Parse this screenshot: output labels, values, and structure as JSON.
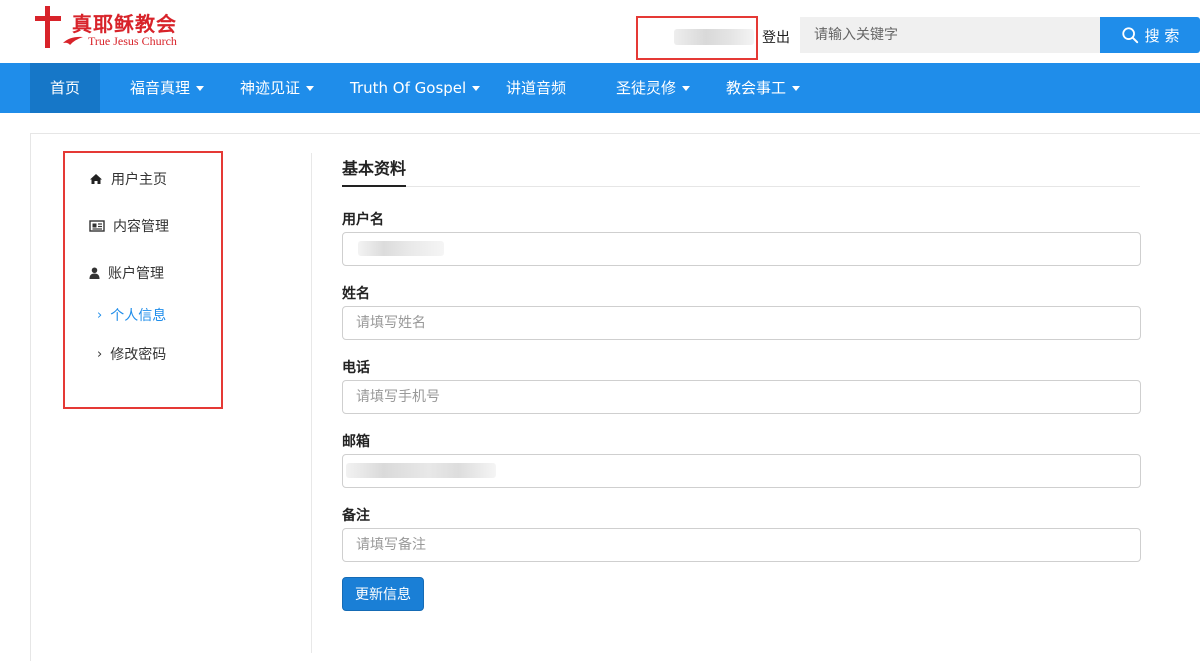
{
  "header": {
    "logo_cn": "真耶稣教会",
    "logo_en": "True Jesus Church",
    "logout_label": "登出",
    "search_placeholder": "请输入关键字",
    "search_button": "搜 索"
  },
  "nav": {
    "items": [
      {
        "label": "首页",
        "dropdown": false,
        "active": true
      },
      {
        "label": "福音真理",
        "dropdown": true,
        "active": false
      },
      {
        "label": "神迹见证",
        "dropdown": true,
        "active": false
      },
      {
        "label": "Truth Of Gospel",
        "dropdown": true,
        "active": false
      },
      {
        "label": "讲道音频",
        "dropdown": false,
        "active": false
      },
      {
        "label": "圣徒灵修",
        "dropdown": true,
        "active": false
      },
      {
        "label": "教会事工",
        "dropdown": true,
        "active": false
      }
    ]
  },
  "sidebar": {
    "items": [
      {
        "label": "用户主页",
        "icon": "home-icon"
      },
      {
        "label": "内容管理",
        "icon": "newspaper-icon"
      },
      {
        "label": "账户管理",
        "icon": "user-icon"
      }
    ],
    "sub_items": [
      {
        "label": "个人信息",
        "active": true
      },
      {
        "label": "修改密码",
        "active": false
      }
    ]
  },
  "form": {
    "title": "基本资料",
    "fields": {
      "username": {
        "label": "用户名",
        "value": "",
        "placeholder": ""
      },
      "name": {
        "label": "姓名",
        "value": "",
        "placeholder": "请填写姓名"
      },
      "phone": {
        "label": "电话",
        "value": "",
        "placeholder": "请填写手机号"
      },
      "email": {
        "label": "邮箱",
        "value": "",
        "placeholder": ""
      },
      "note": {
        "label": "备注",
        "value": "",
        "placeholder": "请填写备注"
      }
    },
    "submit_label": "更新信息"
  },
  "colors": {
    "primary": "#1f8dea",
    "nav_active": "#1677c8",
    "brand_red": "#d8232a",
    "highlight_box": "#e53935",
    "link_active": "#1f8dea"
  }
}
